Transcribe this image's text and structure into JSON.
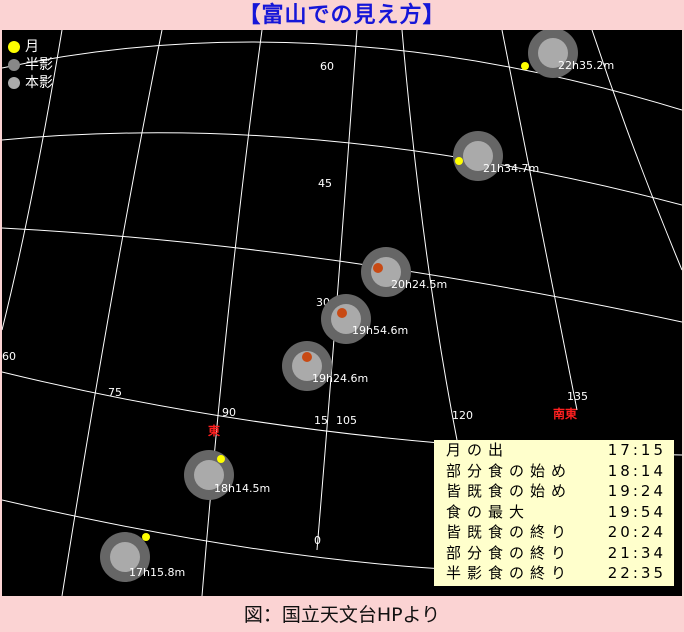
{
  "title": "【富山での見え方】",
  "caption": "図：国立天文台HPより",
  "legend": [
    {
      "label": "月",
      "color": "#ffff00"
    },
    {
      "label": "半影",
      "color": "#888888"
    },
    {
      "label": "本影",
      "color": "#aaaaaa"
    }
  ],
  "altitude_labels": [
    "60",
    "45",
    "30",
    "15",
    "0"
  ],
  "azimuth_labels": [
    "60",
    "75",
    "90",
    "105",
    "120",
    "135"
  ],
  "directions": {
    "east": "東",
    "southeast": "南東"
  },
  "moon_positions": [
    {
      "label": "17h15.8m",
      "moon": true
    },
    {
      "label": "18h14.5m",
      "moon": true
    },
    {
      "label": "19h24.6m",
      "umbral": true
    },
    {
      "label": "19h54.6m",
      "umbral": true
    },
    {
      "label": "20h24.5m",
      "umbral": true
    },
    {
      "label": "21h34.7m",
      "moon": true
    },
    {
      "label": "22h35.2m",
      "moon": true
    }
  ],
  "times": [
    {
      "label": "月の出",
      "time": "17:15"
    },
    {
      "label": "部分食の始め",
      "time": "18:14"
    },
    {
      "label": "皆既食の始め",
      "time": "19:24"
    },
    {
      "label": "食の最大",
      "time": "19:54"
    },
    {
      "label": "皆既食の終り",
      "time": "20:24"
    },
    {
      "label": "部分食の終り",
      "time": "21:34"
    },
    {
      "label": "半影食の終り",
      "time": "22:35"
    }
  ]
}
